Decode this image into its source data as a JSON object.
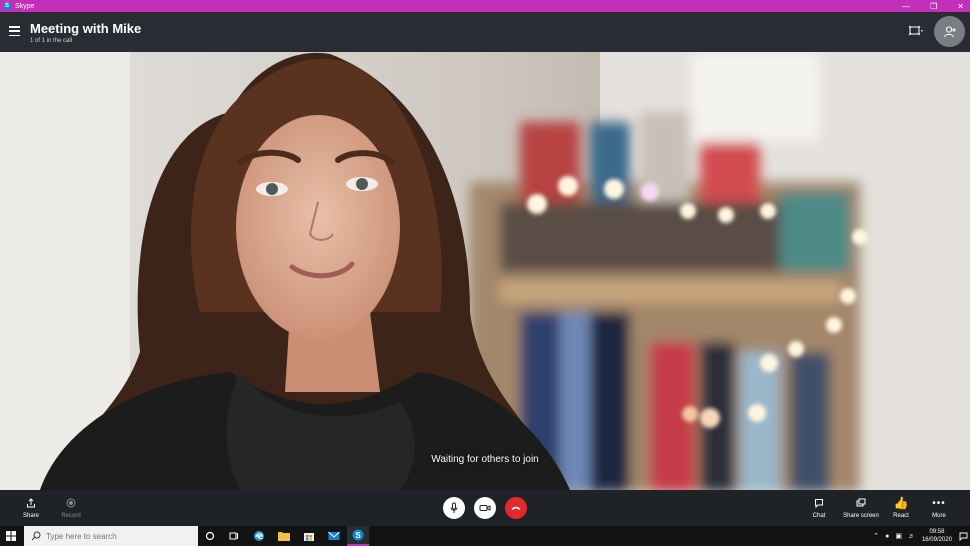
{
  "window": {
    "app_name": "Skype",
    "app_icon": "skype-icon",
    "controls": [
      "minimize-icon",
      "restore-icon",
      "close-icon"
    ]
  },
  "header": {
    "title": "Meeting with Mike",
    "subtitle": "1 of 1 in the call",
    "icons": [
      "hamburger-menu-icon",
      "layout-icon",
      "add-people-icon"
    ]
  },
  "video": {
    "status_text": "Waiting for others to join"
  },
  "controls": {
    "share": "Share",
    "record": "Record",
    "chat": "Chat",
    "share_screen": "Share screen",
    "react": "React",
    "more": "More",
    "round_buttons": [
      "microphone-icon",
      "camera-icon",
      "end-call-icon"
    ]
  },
  "taskbar": {
    "search_placeholder": "Type here to search",
    "apps": [
      "cortana-icon",
      "task-view-icon",
      "edge-icon",
      "file-explorer-icon",
      "store-icon",
      "mail-icon",
      "skype-icon"
    ],
    "time": "09:58",
    "date": "16/09/2020"
  },
  "colors": {
    "title_bar": "#c42fb9",
    "header": "#292d33",
    "controls_bar": "#1f2226",
    "end_call": "#e3282e",
    "taskbar": "#111315"
  }
}
